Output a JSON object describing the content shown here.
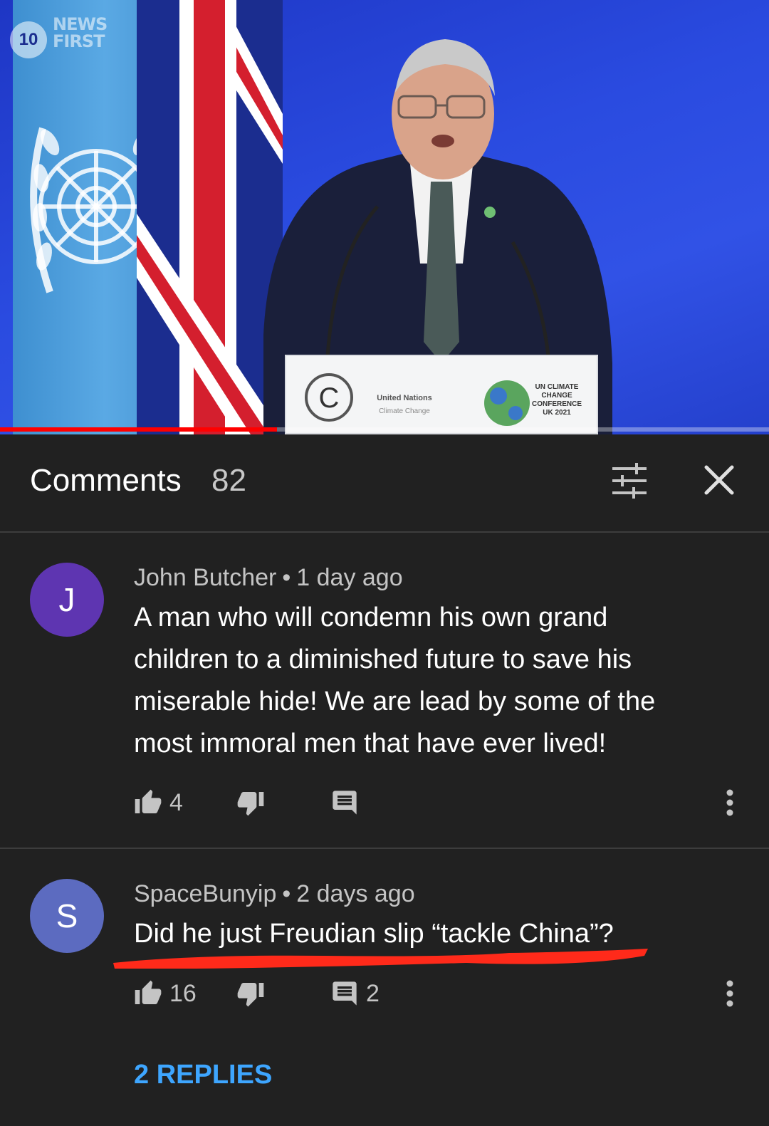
{
  "video": {
    "channel_logo": {
      "badge": "10",
      "line1": "NEWS",
      "line2": "FIRST"
    },
    "progress_fraction": 0.36,
    "podium": {
      "org_line1": "United Nations",
      "org_line2": "Climate Change",
      "conference_lines": [
        "UN CLIMATE",
        "CHANGE",
        "CONFERENCE",
        "UK 2021"
      ]
    }
  },
  "header": {
    "title": "Comments",
    "count": "82",
    "icons": {
      "sort": "sort-filter-icon",
      "close": "close-icon"
    }
  },
  "comments": [
    {
      "avatar_letter": "J",
      "avatar_color": "#5e35b1",
      "author": "John Butcher",
      "time": "1 day ago",
      "text": "A man who will condemn his own grand children to a diminished future to save his miserable hide! We are lead by some of the most immoral men that have ever lived!",
      "likes": "4",
      "replies_count": ""
    },
    {
      "avatar_letter": "S",
      "avatar_color": "#5c6bc0",
      "author": "SpaceBunyip",
      "time": "2 days ago",
      "text": "Did he just Freudian slip “tackle China”?",
      "likes": "16",
      "replies_count": "2",
      "replies_link": "2 REPLIES"
    }
  ],
  "separator": "•",
  "colors": {
    "background": "#212121",
    "link": "#3ea6ff",
    "progress": "#ff0000",
    "annotation": "#ff2a1a"
  }
}
